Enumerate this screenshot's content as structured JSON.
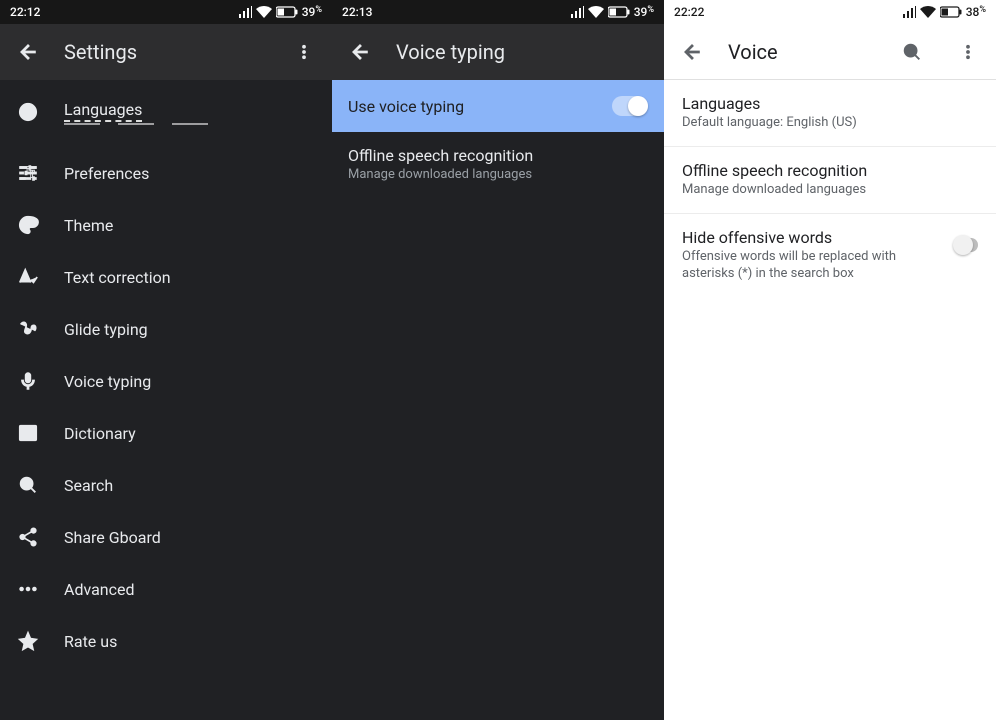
{
  "panel1": {
    "status": {
      "time": "22:12",
      "battery": "39",
      "battery_suffix": "%"
    },
    "title": "Settings",
    "items": [
      {
        "label": "Languages"
      },
      {
        "label": "Preferences"
      },
      {
        "label": "Theme"
      },
      {
        "label": "Text correction"
      },
      {
        "label": "Glide typing"
      },
      {
        "label": "Voice typing"
      },
      {
        "label": "Dictionary"
      },
      {
        "label": "Search"
      },
      {
        "label": "Share Gboard"
      },
      {
        "label": "Advanced"
      },
      {
        "label": "Rate us"
      }
    ]
  },
  "panel2": {
    "status": {
      "time": "22:13",
      "battery": "39",
      "battery_suffix": "%"
    },
    "title": "Voice typing",
    "rows": [
      {
        "title": "Use voice typing",
        "highlight": true,
        "toggle": true
      },
      {
        "title": "Offline speech recognition",
        "subtitle": "Manage downloaded languages"
      }
    ]
  },
  "panel3": {
    "status": {
      "time": "22:22",
      "battery": "38",
      "battery_suffix": "%"
    },
    "title": "Voice",
    "rows": [
      {
        "title": "Languages",
        "subtitle": "Default language: English (US)"
      },
      {
        "title": "Offline speech recognition",
        "subtitle": "Manage downloaded languages"
      },
      {
        "title": "Hide offensive words",
        "subtitle": "Offensive words will be replaced with asterisks (*) in the search box",
        "toggle": false
      }
    ]
  }
}
